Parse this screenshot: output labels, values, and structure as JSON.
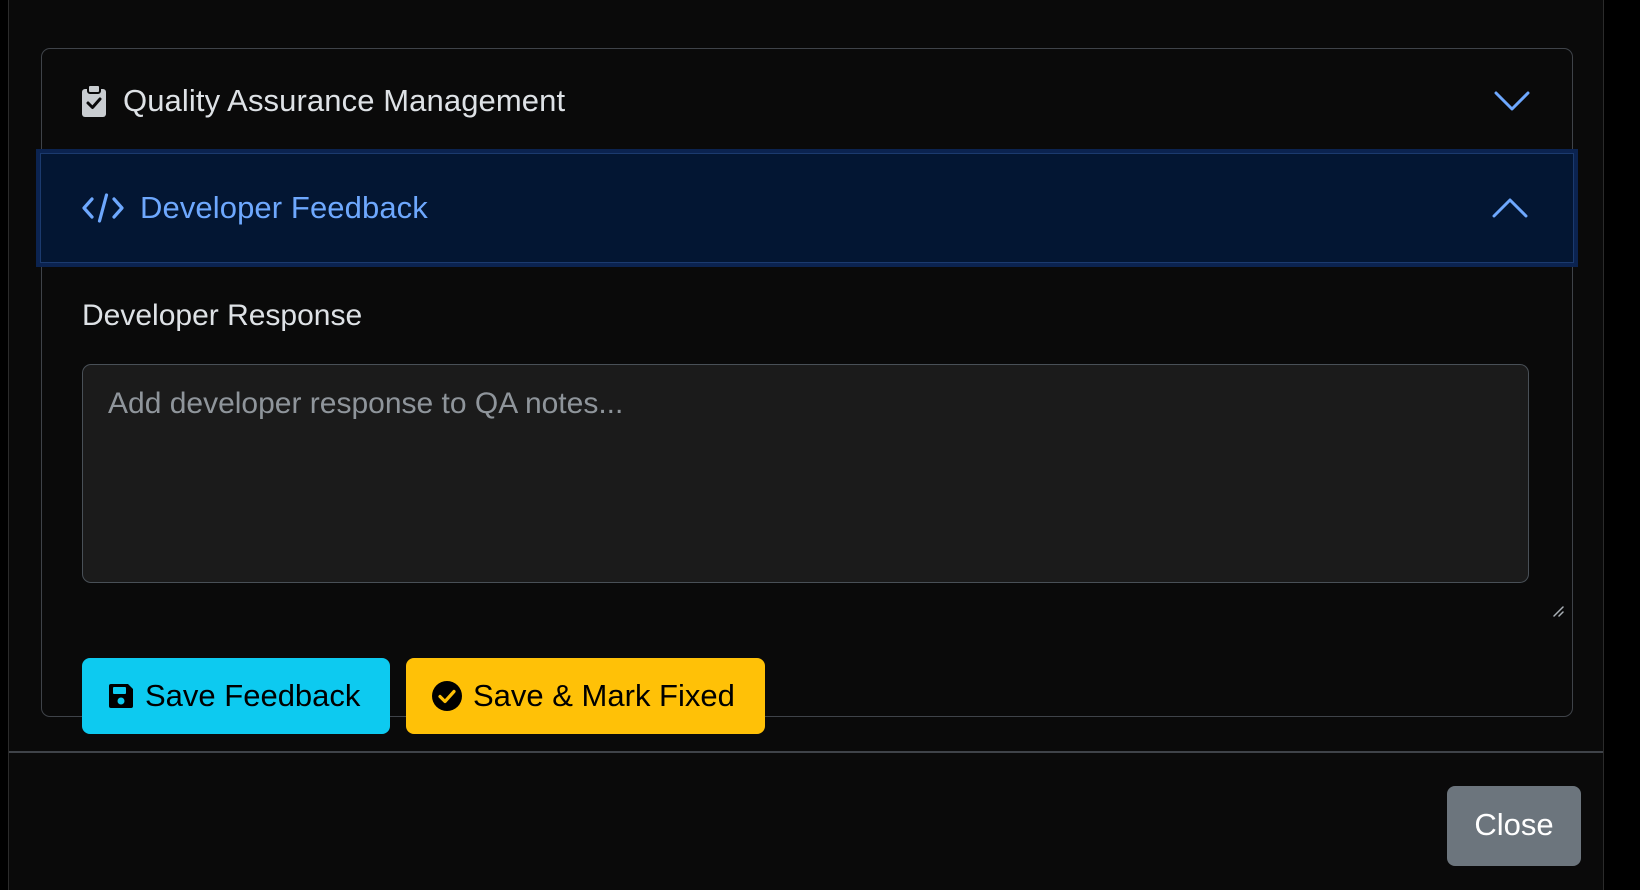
{
  "accordion": {
    "qa": {
      "title": "Quality Assurance Management",
      "icon": "clipboard-check-icon",
      "expanded": false
    },
    "developer": {
      "title": "Developer Feedback",
      "icon": "code-slash-icon",
      "expanded": true,
      "response_label": "Developer Response",
      "response_value": "",
      "response_placeholder": "Add developer response to QA notes...",
      "save_label": "Save Feedback",
      "save_icon": "save-icon",
      "mark_fixed_label": "Save & Mark Fixed",
      "mark_fixed_icon": "check-circle-icon"
    }
  },
  "footer": {
    "close_label": "Close"
  },
  "colors": {
    "info": "#0dcaf0",
    "warning": "#ffc107",
    "secondary": "#6c757d",
    "active_header_bg": "#031633",
    "active_header_text": "#6ea8fe"
  }
}
